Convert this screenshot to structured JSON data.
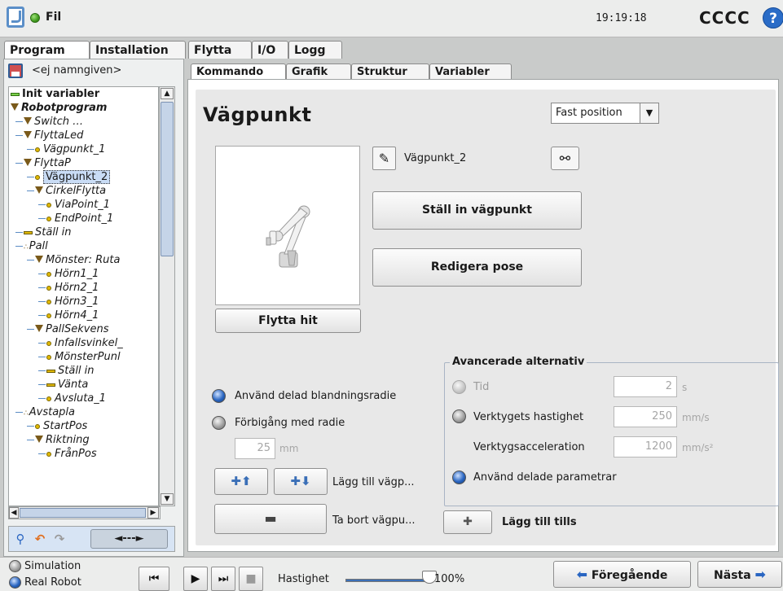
{
  "header": {
    "file_menu": "Fil",
    "clock": "19:19:18",
    "robot_name": "CCCC",
    "help_label": "?"
  },
  "main_tabs": [
    "Program",
    "Installation",
    "Flytta",
    "I/O",
    "Logg"
  ],
  "program": {
    "name": "<ej namngiven>",
    "tree": [
      {
        "label": "Init variabler",
        "icon": "green-bar",
        "level": 0,
        "bold": true,
        "italic": false
      },
      {
        "label": "Robotprogram",
        "icon": "triangle",
        "level": 0,
        "bold": true,
        "italic": true
      },
      {
        "label": "Switch …",
        "icon": "triangle",
        "level": 1
      },
      {
        "label": "FlyttaLed",
        "icon": "triangle",
        "level": 1
      },
      {
        "label": "Vägpunkt_1",
        "icon": "dot",
        "level": 2
      },
      {
        "label": "FlyttaP",
        "icon": "triangle",
        "level": 1
      },
      {
        "label": "Vägpunkt_2",
        "icon": "dot",
        "level": 2,
        "selected": true
      },
      {
        "label": "CirkelFlytta",
        "icon": "triangle",
        "level": 2
      },
      {
        "label": "ViaPoint_1",
        "icon": "dot",
        "level": 3
      },
      {
        "label": "EndPoint_1",
        "icon": "dot",
        "level": 3
      },
      {
        "label": "Ställ in",
        "icon": "bar",
        "level": 1
      },
      {
        "label": "Pall",
        "icon": "pallet",
        "level": 1
      },
      {
        "label": "Mönster: Ruta",
        "icon": "triangle",
        "level": 2
      },
      {
        "label": "Hörn1_1",
        "icon": "dot",
        "level": 3
      },
      {
        "label": "Hörn2_1",
        "icon": "dot",
        "level": 3
      },
      {
        "label": "Hörn3_1",
        "icon": "dot",
        "level": 3
      },
      {
        "label": "Hörn4_1",
        "icon": "dot",
        "level": 3
      },
      {
        "label": "PallSekvens",
        "icon": "triangle",
        "level": 2
      },
      {
        "label": "Infallsvinkel_",
        "icon": "dot",
        "level": 3
      },
      {
        "label": "MönsterPunl",
        "icon": "dot",
        "level": 3
      },
      {
        "label": "Ställ in",
        "icon": "bar",
        "level": 3
      },
      {
        "label": "Vänta",
        "icon": "bar",
        "level": 3
      },
      {
        "label": "Avsluta_1",
        "icon": "dot",
        "level": 3
      },
      {
        "label": "Avstapla",
        "icon": "pallet",
        "level": 1
      },
      {
        "label": "StartPos",
        "icon": "dot",
        "level": 2
      },
      {
        "label": "Riktning",
        "icon": "triangle",
        "level": 2
      },
      {
        "label": "FrånPos",
        "icon": "dot",
        "level": 3
      }
    ],
    "move_button": "◄---►"
  },
  "sub_tabs": [
    "Kommando",
    "Grafik",
    "Struktur",
    "Variabler"
  ],
  "waypoint": {
    "title": "Vägpunkt",
    "position_type": "Fast position",
    "name": "Vägpunkt_2",
    "move_here": "Flytta hit",
    "set_waypoint": "Ställ in vägpunkt",
    "edit_pose": "Redigera pose",
    "use_shared_blend": "Använd delad blandningsradie",
    "pass_with_radius": "Förbigång med radie",
    "radius_value": "25",
    "radius_unit": "mm",
    "add_waypoint": "Lägg till vägp...",
    "remove_waypoint": "Ta bort vägpu...",
    "add_until": "Lägg till tills"
  },
  "advanced": {
    "title": "Avancerade alternativ",
    "time_label": "Tid",
    "time_value": "2",
    "time_unit": "s",
    "tool_speed_label": "Verktygets hastighet",
    "tool_speed_value": "250",
    "tool_speed_unit": "mm/s",
    "tool_accel_label": "Verktygsacceleration",
    "tool_accel_value": "1200",
    "tool_accel_unit": "mm/s²",
    "shared_params": "Använd delade parametrar"
  },
  "footer": {
    "simulation": "Simulation",
    "real_robot": "Real Robot",
    "speed_label": "Hastighet",
    "speed_value": "100%",
    "speed_fraction": 1.0,
    "previous": "Föregående",
    "next": "Nästa"
  }
}
